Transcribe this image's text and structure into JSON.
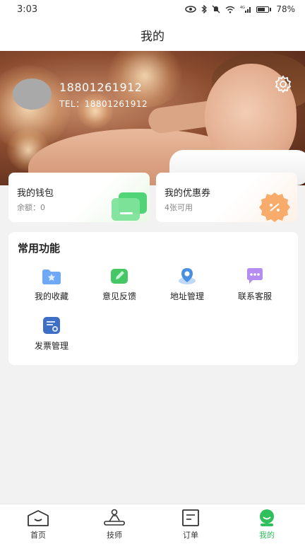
{
  "status_bar": {
    "time": "3:03",
    "battery": "78%",
    "battery_level": 0.78,
    "network_label": "4G"
  },
  "nav": {
    "title": "我的"
  },
  "profile": {
    "phone": "18801261912",
    "tel_label": "TEL：",
    "tel": "18801261912"
  },
  "wallet": {
    "title": "我的钱包",
    "balance_label": "余额：",
    "balance": "0"
  },
  "coupon": {
    "title": "我的优惠券",
    "count_text": "4张可用"
  },
  "functions": {
    "title": "常用功能",
    "items": [
      {
        "label": "我的收藏",
        "icon": "star-folder-icon"
      },
      {
        "label": "意见反馈",
        "icon": "feedback-pencil-icon"
      },
      {
        "label": "地址管理",
        "icon": "location-icon"
      },
      {
        "label": "联系客服",
        "icon": "chat-bubble-icon"
      },
      {
        "label": "发票管理",
        "icon": "invoice-icon"
      }
    ]
  },
  "tabs": [
    {
      "label": "首页",
      "icon": "home-icon",
      "active": false
    },
    {
      "label": "技师",
      "icon": "technician-icon",
      "active": false
    },
    {
      "label": "订单",
      "icon": "order-icon",
      "active": false
    },
    {
      "label": "我的",
      "icon": "profile-icon",
      "active": true
    }
  ],
  "colors": {
    "accent": "#2fbf5c",
    "background": "#f2f2f2",
    "card": "#ffffff",
    "muted_text": "#888888"
  }
}
